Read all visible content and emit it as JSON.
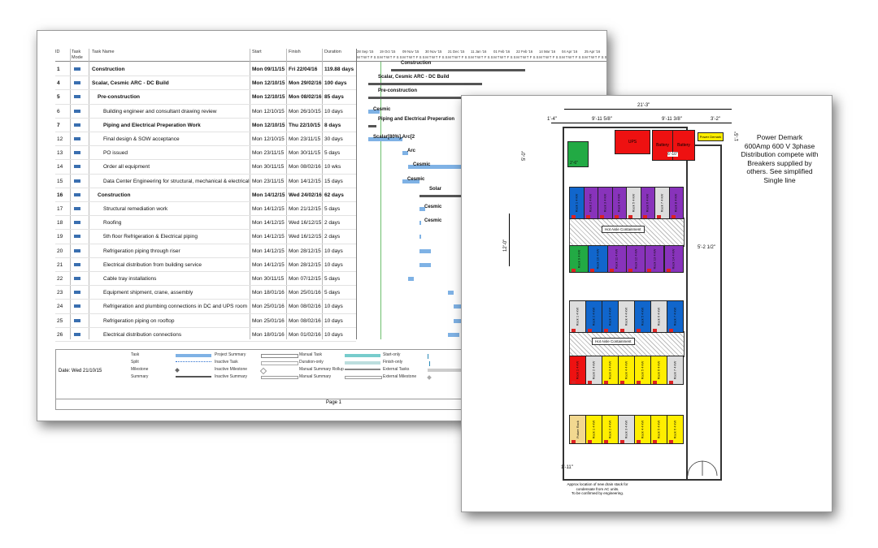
{
  "gantt": {
    "columns": {
      "id": "ID",
      "mode_line1": "Task",
      "mode_line2": "Mode",
      "name": "Task Name",
      "start": "Start",
      "finish": "Finish",
      "duration": "Duration"
    },
    "timescale_months": [
      "28 Sep '15",
      "19 Oct '15",
      "09 Nov '15",
      "30 Nov '15",
      "21 Dec '15",
      "11 Jan '16",
      "01 Feb '16",
      "22 Feb '16",
      "14 Mar '16",
      "04 Apr '16",
      "25 Apr '16"
    ],
    "timescale_days": [
      "M",
      "T",
      "W",
      "T",
      "F",
      "S",
      "S",
      "M",
      "T",
      "W",
      "T",
      "F",
      "S",
      "S",
      "M",
      "T",
      "W",
      "T",
      "F",
      "S",
      "S",
      "M",
      "T",
      "W",
      "T",
      "F",
      "S",
      "S",
      "M",
      "T",
      "W",
      "T",
      "F",
      "S",
      "S",
      "M",
      "T",
      "W",
      "T",
      "F",
      "S",
      "S",
      "M",
      "T",
      "W",
      "T",
      "F",
      "S",
      "S",
      "M",
      "T",
      "W",
      "T",
      "F",
      "S",
      "S",
      "M",
      "T",
      "W",
      "T",
      "F",
      "S",
      "S",
      "M",
      "T",
      "W",
      "T",
      "F",
      "S",
      "S",
      "M",
      "T",
      "W",
      "T",
      "F",
      "S",
      "S",
      "M",
      "T"
    ],
    "rows": [
      {
        "id": "1",
        "name": "Construction",
        "start": "Mon 09/11/15",
        "finish": "Fri 22/04/16",
        "duration": "119.88 days",
        "bold": true,
        "indent": 0
      },
      {
        "id": "4",
        "name": "Scalar, Cesmic ARC - DC Build",
        "start": "Mon 12/10/15",
        "finish": "Mon 29/02/16",
        "duration": "100 days",
        "bold": true,
        "indent": 0
      },
      {
        "id": "5",
        "name": "Pre-construction",
        "start": "Mon 12/10/15",
        "finish": "Mon 08/02/16",
        "duration": "85 days",
        "bold": true,
        "indent": 1
      },
      {
        "id": "6",
        "name": "Building engineer and consultant drawing review",
        "start": "Mon 12/10/15",
        "finish": "Mon 26/10/15",
        "duration": "10 days",
        "bold": false,
        "indent": 2
      },
      {
        "id": "7",
        "name": "Piping and Electrical Preperation Work",
        "start": "Mon 12/10/15",
        "finish": "Thu 22/10/15",
        "duration": "8 days",
        "bold": true,
        "indent": 2
      },
      {
        "id": "12",
        "name": "Final design & SOW acceptance",
        "start": "Mon 12/10/15",
        "finish": "Mon 23/11/15",
        "duration": "30 days",
        "bold": false,
        "indent": 2
      },
      {
        "id": "13",
        "name": "PO issued",
        "start": "Mon 23/11/15",
        "finish": "Mon 30/11/15",
        "duration": "5 days",
        "bold": false,
        "indent": 2
      },
      {
        "id": "14",
        "name": "Order all equipment",
        "start": "Mon 30/11/15",
        "finish": "Mon 08/02/16",
        "duration": "10 wks",
        "bold": false,
        "indent": 2
      },
      {
        "id": "15",
        "name": "Data Center Engineering for structural, mechanical & electrical",
        "start": "Mon 23/11/15",
        "finish": "Mon 14/12/15",
        "duration": "15 days",
        "bold": false,
        "indent": 2
      },
      {
        "id": "16",
        "name": "Construction",
        "start": "Mon 14/12/15",
        "finish": "Wed 24/02/16",
        "duration": "62 days",
        "bold": true,
        "indent": 1
      },
      {
        "id": "17",
        "name": "Structural remediation work",
        "start": "Mon 14/12/15",
        "finish": "Mon 21/12/15",
        "duration": "5 days",
        "bold": false,
        "indent": 2
      },
      {
        "id": "18",
        "name": "Roofing",
        "start": "Mon 14/12/15",
        "finish": "Wed 16/12/15",
        "duration": "2 days",
        "bold": false,
        "indent": 2
      },
      {
        "id": "19",
        "name": "5th floor Refrigeration & Electrical piping",
        "start": "Mon 14/12/15",
        "finish": "Wed 16/12/15",
        "duration": "2 days",
        "bold": false,
        "indent": 2
      },
      {
        "id": "20",
        "name": "Refrigeration piping through riser",
        "start": "Mon 14/12/15",
        "finish": "Mon 28/12/15",
        "duration": "10 days",
        "bold": false,
        "indent": 2
      },
      {
        "id": "21",
        "name": "Electrical distribution from building service",
        "start": "Mon 14/12/15",
        "finish": "Mon 28/12/15",
        "duration": "10 days",
        "bold": false,
        "indent": 2
      },
      {
        "id": "22",
        "name": "Cable tray installations",
        "start": "Mon 30/11/15",
        "finish": "Mon 07/12/15",
        "duration": "5 days",
        "bold": false,
        "indent": 2
      },
      {
        "id": "23",
        "name": "Equipment shipment, crane, assembly",
        "start": "Mon 18/01/16",
        "finish": "Mon 25/01/16",
        "duration": "5 days",
        "bold": false,
        "indent": 2
      },
      {
        "id": "24",
        "name": "Refrigeration and plumbing connections in DC and UPS room",
        "start": "Mon 25/01/16",
        "finish": "Mon 08/02/16",
        "duration": "10 days",
        "bold": false,
        "indent": 2
      },
      {
        "id": "25",
        "name": "Refrigeration piping on rooftop",
        "start": "Mon 25/01/16",
        "finish": "Mon 08/02/16",
        "duration": "10 days",
        "bold": false,
        "indent": 2
      },
      {
        "id": "26",
        "name": "Electrical distribution connections",
        "start": "Mon 18/01/16",
        "finish": "Mon 01/02/16",
        "duration": "10 days",
        "bold": false,
        "indent": 2
      }
    ],
    "bar_labels": [
      "Construction",
      "Scalar, Cesmic ARC - DC Build",
      "Pre-construction",
      "Cesmic",
      "Piping and Electrical Preperation",
      "Scalar[80%],Arc[2",
      "Arc",
      "Cesmic",
      "Cesmic",
      "Solar",
      "Cesmic",
      "Cesmic"
    ],
    "footer": {
      "date": "Date: Wed 21/10/15",
      "page": "Page 1",
      "legend": [
        [
          "Task",
          "Project Summary",
          "Manual Task",
          "Start-only"
        ],
        [
          "Split",
          "Inactive Task",
          "Duration-only",
          "Finish-only"
        ],
        [
          "Milestone",
          "Inactive Milestone",
          "Manual Summary Rollup",
          "External Tasks"
        ],
        [
          "Summary",
          "Inactive Summary",
          "Manual Summary",
          "External Milestone"
        ]
      ]
    },
    "colors": {
      "bar": "#7fb2e5",
      "summary": "#555555",
      "manual": "#77cccc"
    }
  },
  "plan": {
    "title_lines": [
      "Power Demark",
      "600Amp 600 V 3phase",
      "Distribution compete with",
      "Breakers supplied by",
      "others. See simplified",
      "Single line"
    ],
    "dims": {
      "total_width": "21'-3\"",
      "left_offset": "1'-4\"",
      "left_span": "9'-11 5/8\"",
      "right_span": "9'-11 3/8\"",
      "right_tail": "3'-2\"",
      "top_small": "1'-5\"",
      "upper_height": "5'-0\"",
      "side_a": "3'-0\"",
      "side_b": "6'-0\"",
      "side_total": "12'-0\"",
      "aisle_offset": "5'-2 1/2\"",
      "bottom_left": "1'-11\"",
      "mid_a": "2'-0\""
    },
    "equipment": {
      "ups": "UPS",
      "battery_1": "Battery",
      "battery_2": "Battery",
      "power_demark": "Power Demark",
      "battery_dim": "6'-10\"",
      "small_box_dim": "2'-6\""
    },
    "containment_labels": [
      "Hot Aisle Containment",
      "Hot Aisle Containment"
    ],
    "racks": {
      "row1": [
        "Rack 1 4 kW",
        "Rack 2 4 kW",
        "Rack 3 4 kW",
        "Rack 4 4 kW",
        "Rack 5 4 kW",
        "Rack 6 4 kW",
        "Rack 7 4 kW",
        "Rack 8 4 kW"
      ],
      "row2": [
        "Rack 9 4 kW",
        "Rack 10 4 kW",
        "Rack 11 4 kW",
        "Rack 12 4 kW",
        "Rack 13 4 kW",
        "Rack 14 4 kW"
      ],
      "row3": [
        "Rack 1 4 kW",
        "Rack 2 4 kW",
        "Rack 3 4 kW",
        "Rack 4 4 kW",
        "Rack 5 4 kW",
        "Rack 6 4 kW",
        "Rack 7 4 kW"
      ],
      "row4": [
        "Rack 1 4 kW",
        "Rack 2 4 kW",
        "Rack 3 4 kW",
        "Rack 4 4 kW",
        "Rack 5 4 kW",
        "Rack 6 4 kW",
        "Rack 7 4 kW"
      ],
      "row5": [
        "Future Rack",
        "Rack 1 4 kW",
        "Rack 2 4 kW",
        "Rack 3 4 kW",
        "Rack 4 4 kW",
        "Rack 5 4 kW",
        "Rack 6 4 kW"
      ]
    },
    "note_lines": [
      "Approx location of new drain stack for",
      "condensate from AC units.",
      "To be confirmed by engineering."
    ]
  }
}
